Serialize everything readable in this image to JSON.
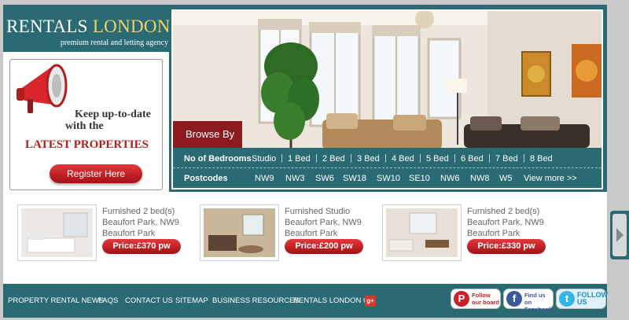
{
  "logo": {
    "main_part1": "RENTALS ",
    "main_part2": "LONDON",
    "tagline": "premium rental and letting agency"
  },
  "promo": {
    "line1": "Keep up-to-date",
    "line2": "with the",
    "title": "LATEST PROPERTIES",
    "button": "Register Here"
  },
  "browse": {
    "label": "Browse By",
    "bedrooms_label": "No of Bedrooms",
    "bedrooms": [
      "Studio",
      "1 Bed",
      "2 Bed",
      "3 Bed",
      "4 Bed",
      "5 Bed",
      "6 Bed",
      "7 Bed",
      "8 Bed"
    ],
    "postcodes_label": "Postcodes",
    "postcodes": [
      "NW9",
      "NW3",
      "SW6",
      "SW18",
      "SW10",
      "SE10",
      "NW6",
      "NW8",
      "W5"
    ],
    "view_more": "View more >>"
  },
  "listings": [
    {
      "line1": "Furnished 2 bed(s)",
      "line2": "Beaufort Park, NW9",
      "line3": "Beaufort Park",
      "price": "Price:£370 pw"
    },
    {
      "line1": "Furnished Studio",
      "line2": "Beaufort Park, NW9",
      "line3": "Beaufort Park",
      "price": "Price:£200 pw"
    },
    {
      "line1": "Furnished 2 bed(s)",
      "line2": "Beaufort Park, NW9",
      "line3": "Beaufort Park",
      "price": "Price:£330 pw"
    }
  ],
  "footer": {
    "links": [
      "PROPERTY RENTAL NEWS",
      "FAQS",
      "CONTACT US",
      "SITEMAP",
      "BUSINESS RESOURCES",
      "RENTALS LONDON ON"
    ],
    "gplus": "g+",
    "pinterest": {
      "line1": "Follow",
      "line2": "our board"
    },
    "facebook": {
      "line1": "Find us on",
      "line2": "Facebook"
    },
    "twitter": {
      "line1": "FOLLOW",
      "line2": "US"
    }
  },
  "colors": {
    "teal": "#2a6b73",
    "red": "#b01e1e",
    "browse_red": "#8d1a1f"
  }
}
